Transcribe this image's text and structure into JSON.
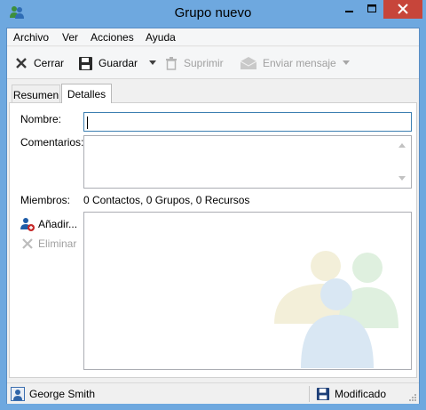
{
  "window": {
    "title": "Grupo nuevo"
  },
  "menu": [
    "Archivo",
    "Ver",
    "Acciones",
    "Ayuda"
  ],
  "toolbar": {
    "close_label": "Cerrar",
    "save_label": "Guardar",
    "delete_label": "Suprimir",
    "send_label": "Enviar mensaje"
  },
  "tabs": [
    {
      "label": "Resumen",
      "active": false
    },
    {
      "label": "Detalles",
      "active": true
    }
  ],
  "form": {
    "name_label": "Nombre:",
    "name_value": "",
    "comments_label": "Comentarios:",
    "comments_value": "",
    "members_label": "Miembros:",
    "members_summary": "0 Contactos, 0 Grupos, 0 Recursos",
    "add_label": "Añadir...",
    "remove_label": "Eliminar"
  },
  "status": {
    "user": "George Smith",
    "state": "Modificado"
  },
  "colors": {
    "titlebar": "#6ea8df",
    "close_button": "#c7453a",
    "focus_border": "#3c7fb1"
  }
}
